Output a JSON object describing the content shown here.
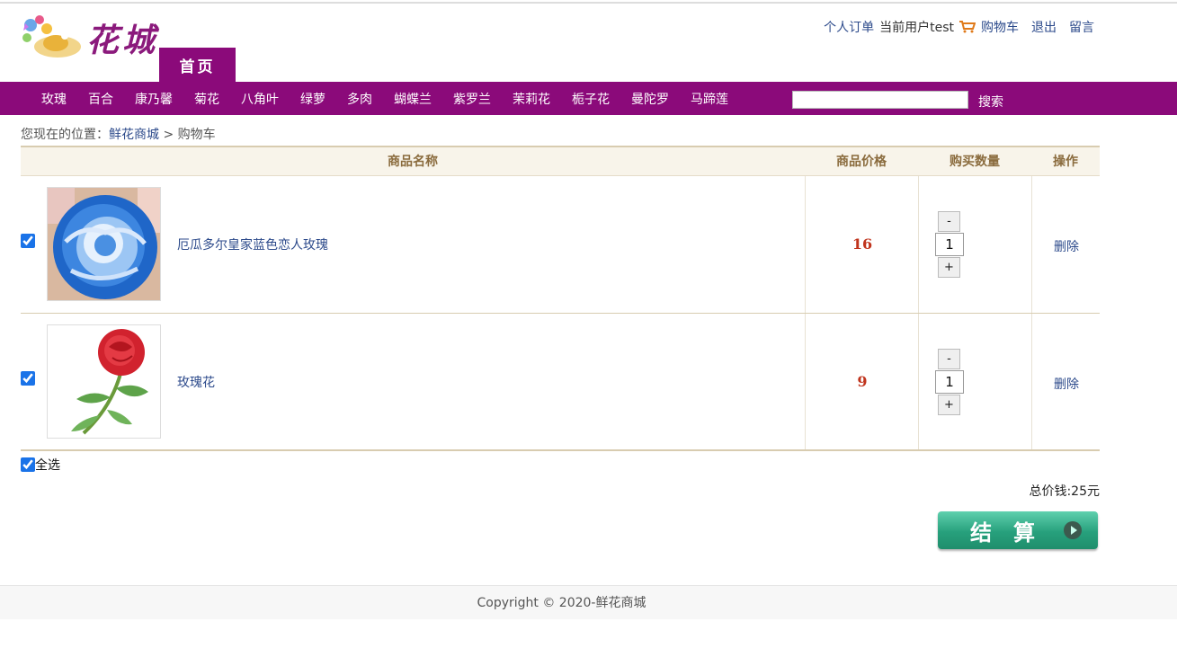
{
  "logo": {
    "text": "花城"
  },
  "header": {
    "home_tab": "首页",
    "orders_link": "个人订单",
    "current_user": "当前用户test",
    "cart_link": "购物车",
    "logout_link": "退出",
    "message_link": "留言"
  },
  "nav": {
    "items": [
      "玫瑰",
      "百合",
      "康乃馨",
      "菊花",
      "八角叶",
      "绿萝",
      "多肉",
      "蝴蝶兰",
      "紫罗兰",
      "茉莉花",
      "栀子花",
      "曼陀罗",
      "马蹄莲"
    ],
    "search_button": "搜索"
  },
  "breadcrumb": {
    "prefix": "您现在的位置：",
    "home": "鲜花商城",
    "separator": ">",
    "current": "购物车"
  },
  "table": {
    "headers": {
      "name": "商品名称",
      "price": "商品价格",
      "qty": "购买数量",
      "op": "操作"
    },
    "rows": [
      {
        "name": "厄瓜多尔皇家蓝色恋人玫瑰",
        "price": "16",
        "qty": "1",
        "minus": "-",
        "plus": "+",
        "delete": "删除"
      },
      {
        "name": "玫瑰花",
        "price": "9",
        "qty": "1",
        "minus": "-",
        "plus": "+",
        "delete": "删除"
      }
    ]
  },
  "select_all": "全选",
  "total": "总价钱:25元",
  "checkout": "结算",
  "footer": "Copyright © 2020-鲜花商城",
  "colors": {
    "brand_purple": "#8b0a7a",
    "link_blue": "#2c4a8b",
    "price_red": "#c0341d",
    "checkout_green": "#27a07c"
  }
}
